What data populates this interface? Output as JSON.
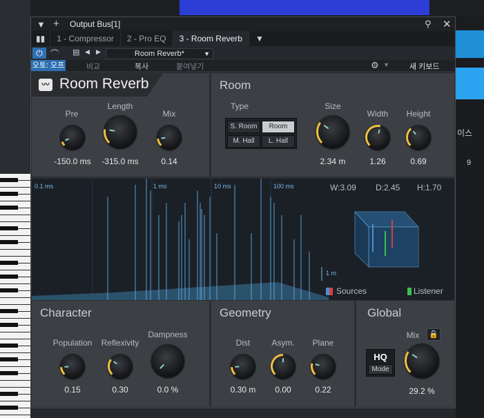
{
  "window": {
    "title": "Output Bus[1]"
  },
  "tabs": [
    {
      "label": "1 - Compressor",
      "active": false
    },
    {
      "label": "2 - Pro EQ",
      "active": false
    },
    {
      "label": "3 - Room Reverb",
      "active": true
    }
  ],
  "toolbar": {
    "preset_name": "Room Reverb*",
    "auto_label": "오토: 오프",
    "compare_label": "비교",
    "copy_label": "복사",
    "paste_label": "붙여넣기",
    "keyboard_label": "새 키보드"
  },
  "plugin": {
    "name": "Room Reverb",
    "pre": {
      "label": "Pre",
      "value": "-150.0 ms"
    },
    "length": {
      "label": "Length",
      "value": "-315.0 ms"
    },
    "mix": {
      "label": "Mix",
      "value": "0.14"
    }
  },
  "room": {
    "title": "Room",
    "type_label": "Type",
    "types": [
      "S. Room",
      "Room",
      "M. Hall",
      "L. Hall"
    ],
    "selected_type": "Room",
    "size": {
      "label": "Size",
      "value": "2.34 m"
    },
    "width": {
      "label": "Width",
      "value": "1.26"
    },
    "height": {
      "label": "Height",
      "value": "0.69"
    }
  },
  "visualizer": {
    "time_labels": [
      "0.1 ms",
      "1 ms",
      "10 ms",
      "100 ms"
    ],
    "w_label": "W:3.09",
    "d_label": "D:2.45",
    "h_label": "H:1.70",
    "scale_label": "1 m",
    "sources_label": "Sources",
    "listener_label": "Listener"
  },
  "character": {
    "title": "Character",
    "population": {
      "label": "Population",
      "value": "0.15"
    },
    "reflexivity": {
      "label": "Reflexivity",
      "value": "0.30"
    },
    "dampness": {
      "label": "Dampness",
      "value": "0.0 %"
    }
  },
  "geometry": {
    "title": "Geometry",
    "dist": {
      "label": "Dist",
      "value": "0.30 m"
    },
    "asym": {
      "label": "Asym.",
      "value": "0.00"
    },
    "plane": {
      "label": "Plane",
      "value": "0.22"
    }
  },
  "global": {
    "title": "Global",
    "mix": {
      "label": "Mix",
      "value": "29.2 %"
    },
    "hq_label": "HQ",
    "mode_label": "Mode"
  },
  "host": {
    "ruler_number": "9",
    "side_text": "이스"
  },
  "colors": {
    "accent": "#f0c040",
    "blue": "#2e6fb2",
    "viz_line": "#5aa6de"
  }
}
